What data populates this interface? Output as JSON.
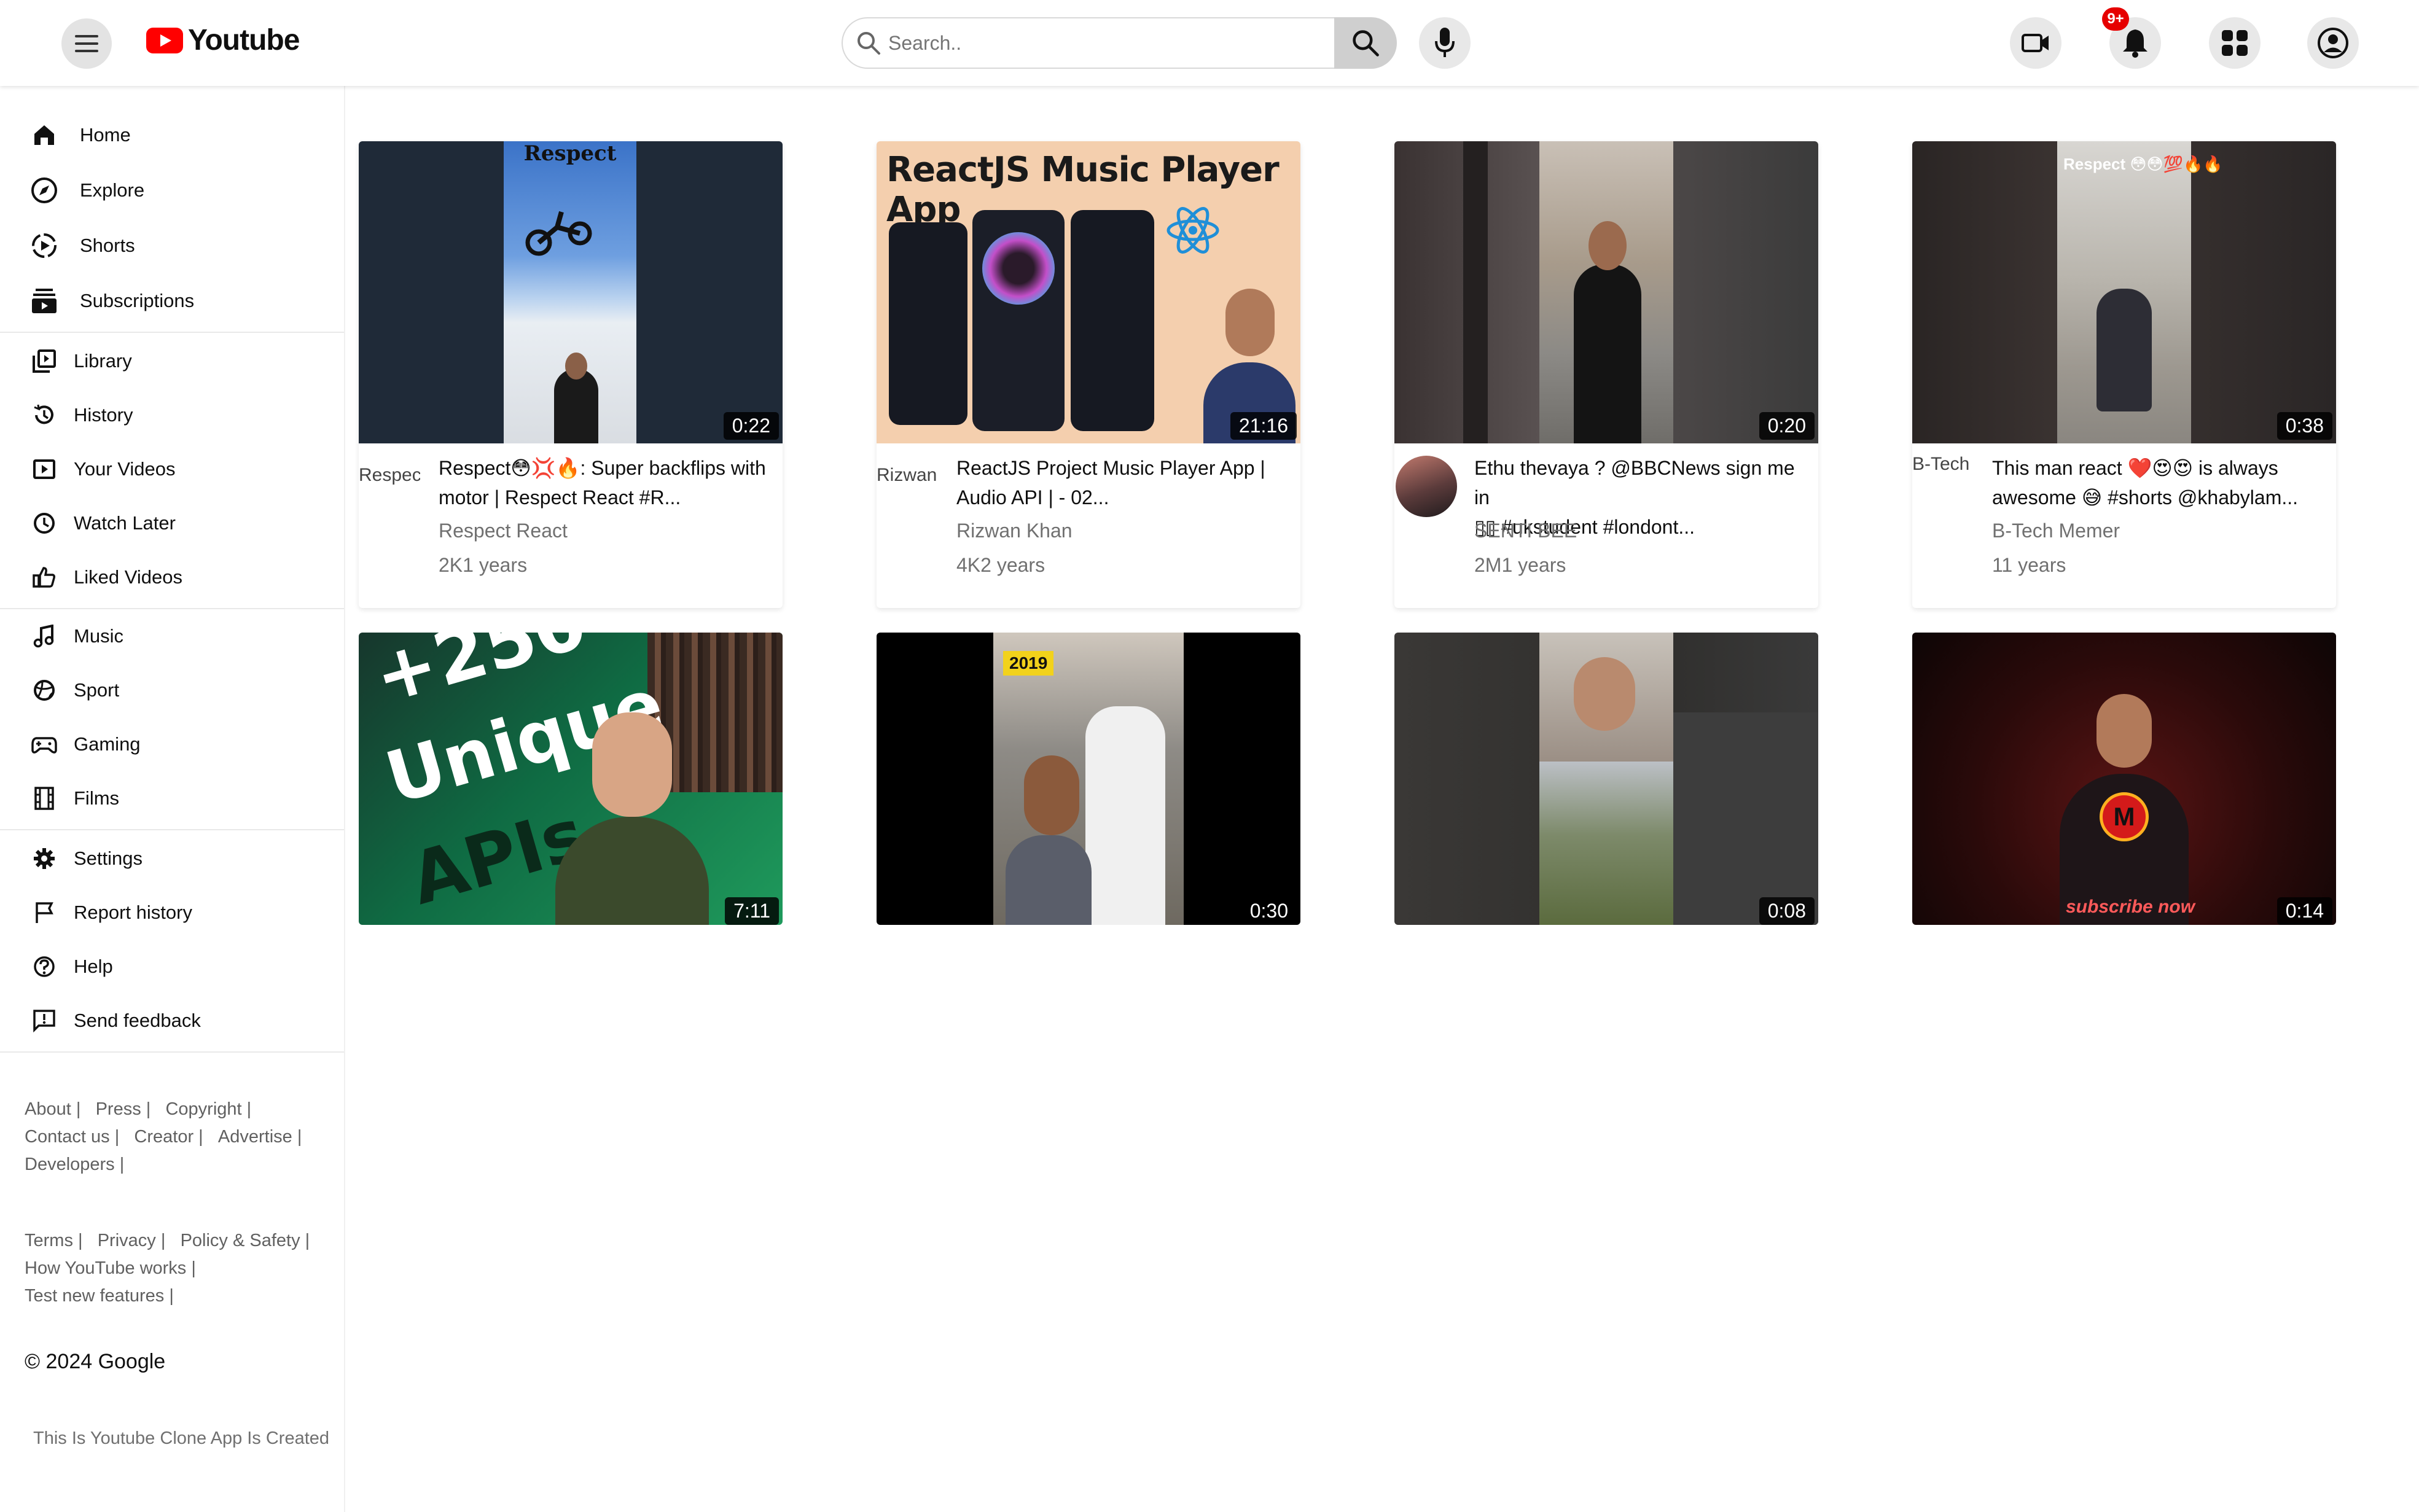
{
  "header": {
    "logo_text": "Youtube",
    "search_placeholder": "Search..",
    "notification_count": "9+"
  },
  "sidebar": {
    "items": [
      {
        "label": "Home",
        "icon": "home-icon"
      },
      {
        "label": "Explore",
        "icon": "compass-icon"
      },
      {
        "label": "Shorts",
        "icon": "shorts-icon"
      },
      {
        "label": "Subscriptions",
        "icon": "subscriptions-icon"
      },
      {
        "label": "Library",
        "icon": "library-icon"
      },
      {
        "label": "History",
        "icon": "history-icon"
      },
      {
        "label": "Your Videos",
        "icon": "your-videos-icon"
      },
      {
        "label": "Watch Later",
        "icon": "clock-icon"
      },
      {
        "label": "Liked Videos",
        "icon": "thumbs-up-icon"
      },
      {
        "label": "Music",
        "icon": "music-icon"
      },
      {
        "label": "Sport",
        "icon": "sport-icon"
      },
      {
        "label": "Gaming",
        "icon": "gamepad-icon"
      },
      {
        "label": "Films",
        "icon": "film-icon"
      },
      {
        "label": "Settings",
        "icon": "gear-icon"
      },
      {
        "label": "Report history",
        "icon": "flag-icon"
      },
      {
        "label": "Help",
        "icon": "help-icon"
      },
      {
        "label": "Send feedback",
        "icon": "feedback-icon"
      }
    ],
    "footer_links_1": [
      "About",
      "Press",
      "Copyright",
      "Contact us",
      "Creator",
      "Advertise",
      "Developers"
    ],
    "footer_links_2": [
      "Terms",
      "Privacy",
      "Policy & Safety",
      "How YouTube works",
      "Test new features"
    ],
    "copyright": "© 2024 Google",
    "created_note": "This Is Youtube Clone App Is Created"
  },
  "videos": [
    {
      "title_line1": "Respect😳💢🔥: Super backflips with",
      "title_line2": "motor | Respect React #R...",
      "channel": "Respect React",
      "views": "2K1 years",
      "duration": "0:22",
      "avatar_alt": "Respec"
    },
    {
      "title_line1": "ReactJS Project Music Player App |",
      "title_line2": "Audio API | - 02...",
      "channel": "Rizwan Khan",
      "views": "4K2 years",
      "duration": "21:16",
      "avatar_alt": "Rizwan"
    },
    {
      "title_line1": "Ethu thevaya ? @BBCNews sign me in",
      "title_line2": "▯▯ #ukstudent #londont...",
      "channel": "SENTI BEE",
      "views": "2M1 years",
      "duration": "0:20",
      "avatar_alt": ""
    },
    {
      "title_line1": "This man react ❤️😍😍 is always",
      "title_line2": "awesome 😅 #shorts @khabylam...",
      "channel": "B-Tech Memer",
      "views": "11 years",
      "duration": "0:38",
      "avatar_alt": "B-Tech"
    },
    {
      "duration": "7:11"
    },
    {
      "duration": "0:30"
    },
    {
      "duration": "0:08"
    },
    {
      "duration": "0:14"
    }
  ],
  "thumbnail_text": {
    "respect": "Respect",
    "music_player": "ReactJS Music Player App",
    "respect_tag": "Respect 😳😳💯🔥🔥",
    "apis_1": "+250",
    "apis_2": "Unique",
    "apis_3": "APIs",
    "year_badge": "2019",
    "subscribe": "subscribe now",
    "m_logo": "M"
  },
  "colors": {
    "brand_red": "#ff0000",
    "badge_red": "#e60000",
    "secondary_text": "#707070"
  }
}
